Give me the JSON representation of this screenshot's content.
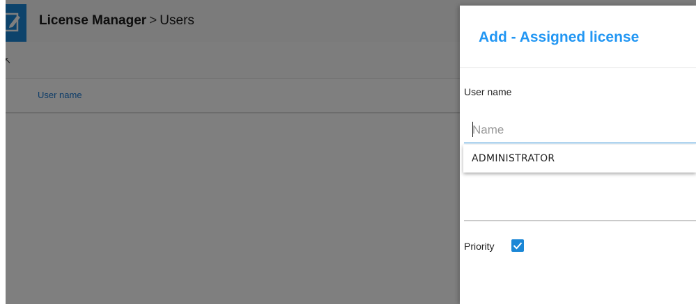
{
  "header": {
    "breadcrumb_root": "License Manager",
    "breadcrumb_separator": ">",
    "breadcrumb_current": "Users",
    "logo_icon": "edit-document-icon"
  },
  "toolbar": {
    "back_icon": "back-arrow-icon"
  },
  "table": {
    "columns": [
      "User name"
    ]
  },
  "panel": {
    "title": "Add - Assigned license",
    "user_name_label": "User name",
    "user_name_input": {
      "value": "",
      "placeholder": "Name"
    },
    "suggestions": [
      "ADMINISTRATOR"
    ],
    "priority_label": "Priority",
    "priority_checked": true
  },
  "colors": {
    "accent": "#2196f3",
    "brand": "#1b87d6",
    "overlay": "rgba(0,0,0,0.5)"
  }
}
